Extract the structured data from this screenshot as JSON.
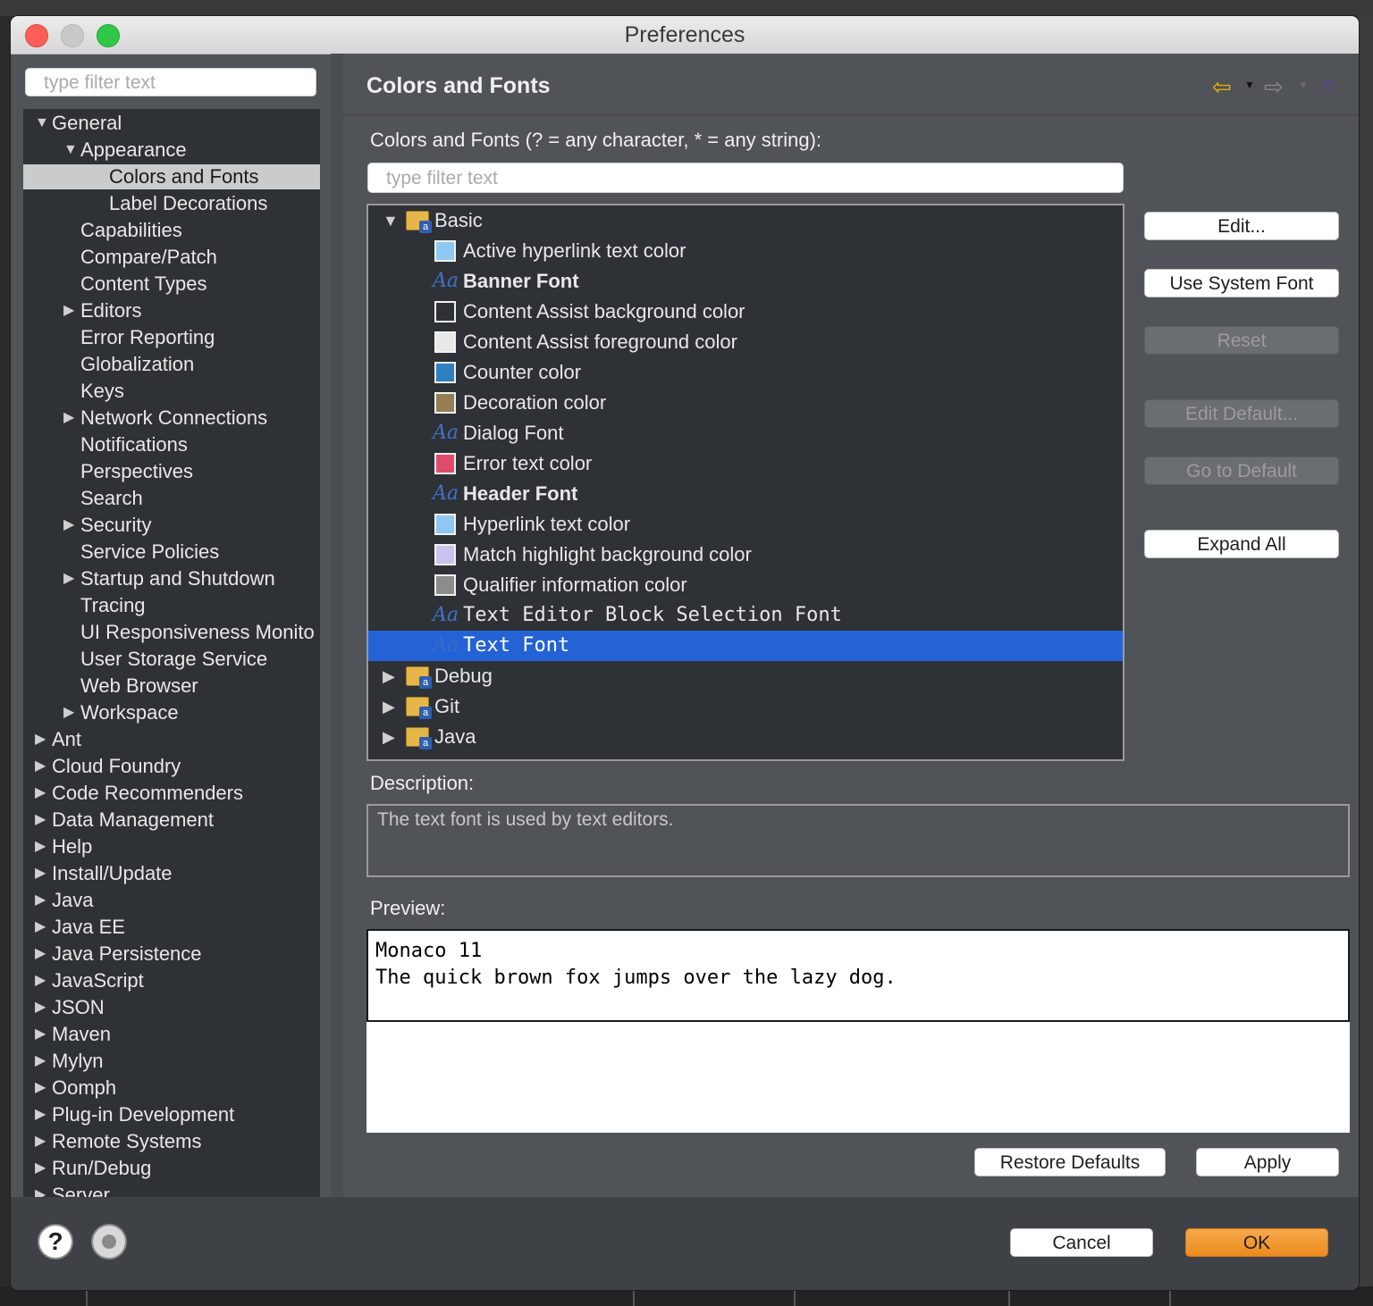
{
  "window": {
    "title": "Preferences"
  },
  "left": {
    "filter_placeholder": "type filter text",
    "tree": [
      {
        "label": "General",
        "expanded": true
      },
      {
        "label": "Appearance",
        "expanded": true
      },
      {
        "label": "Colors and Fonts",
        "selected": true
      },
      {
        "label": "Label Decorations"
      },
      {
        "label": "Capabilities"
      },
      {
        "label": "Compare/Patch"
      },
      {
        "label": "Content Types"
      },
      {
        "label": "Editors"
      },
      {
        "label": "Error Reporting"
      },
      {
        "label": "Globalization"
      },
      {
        "label": "Keys"
      },
      {
        "label": "Network Connections"
      },
      {
        "label": "Notifications"
      },
      {
        "label": "Perspectives"
      },
      {
        "label": "Search"
      },
      {
        "label": "Security"
      },
      {
        "label": "Service Policies"
      },
      {
        "label": "Startup and Shutdown"
      },
      {
        "label": "Tracing"
      },
      {
        "label": "UI Responsiveness Monito"
      },
      {
        "label": "User Storage Service"
      },
      {
        "label": "Web Browser"
      },
      {
        "label": "Workspace"
      },
      {
        "label": "Ant"
      },
      {
        "label": "Cloud Foundry"
      },
      {
        "label": "Code Recommenders"
      },
      {
        "label": "Data Management"
      },
      {
        "label": "Help"
      },
      {
        "label": "Install/Update"
      },
      {
        "label": "Java"
      },
      {
        "label": "Java EE"
      },
      {
        "label": "Java Persistence"
      },
      {
        "label": "JavaScript"
      },
      {
        "label": "JSON"
      },
      {
        "label": "Maven"
      },
      {
        "label": "Mylyn"
      },
      {
        "label": "Oomph"
      },
      {
        "label": "Plug-in Development"
      },
      {
        "label": "Remote Systems"
      },
      {
        "label": "Run/Debug"
      },
      {
        "label": "Server"
      }
    ]
  },
  "page": {
    "title": "Colors and Fonts",
    "filter_label": "Colors and Fonts (? = any character, * = any string):",
    "filter_placeholder": "type filter text",
    "tree": [
      {
        "label": "Basic",
        "kind": "category"
      },
      {
        "label": "Active hyperlink text color",
        "kind": "color",
        "color": "#8ec8f2"
      },
      {
        "label": "Banner Font",
        "kind": "font"
      },
      {
        "label": "Content Assist background color",
        "kind": "color",
        "color": "#2f3136"
      },
      {
        "label": "Content Assist foreground color",
        "kind": "color",
        "color": "#e8e8e8"
      },
      {
        "label": "Counter color",
        "kind": "color",
        "color": "#2e80c0"
      },
      {
        "label": "Decoration color",
        "kind": "color",
        "color": "#957e52"
      },
      {
        "label": "Dialog Font",
        "kind": "font"
      },
      {
        "label": "Error text color",
        "kind": "color",
        "color": "#e04b6c"
      },
      {
        "label": "Header Font",
        "kind": "font"
      },
      {
        "label": "Hyperlink text color",
        "kind": "color",
        "color": "#8ec8f2"
      },
      {
        "label": "Match highlight background color",
        "kind": "color",
        "color": "#c8c4f0"
      },
      {
        "label": "Qualifier information color",
        "kind": "color",
        "color": "#8c8c8c"
      },
      {
        "label": "Text Editor Block Selection Font",
        "kind": "font"
      },
      {
        "label": "Text Font",
        "kind": "font",
        "selected": true
      },
      {
        "label": "Debug",
        "kind": "category"
      },
      {
        "label": "Git",
        "kind": "category"
      },
      {
        "label": "Java",
        "kind": "category"
      }
    ],
    "buttons": {
      "edit": "Edit...",
      "use_system_font": "Use System Font",
      "reset": "Reset",
      "edit_default": "Edit Default...",
      "go_to_default": "Go to Default",
      "expand_all": "Expand All"
    },
    "description_label": "Description:",
    "description": "The text font is used by text editors.",
    "preview_label": "Preview:",
    "preview_line1": "Monaco 11",
    "preview_line2": "The quick brown fox jumps over the lazy dog.",
    "restore_defaults": "Restore Defaults",
    "apply": "Apply"
  },
  "footer": {
    "cancel": "Cancel",
    "ok": "OK"
  },
  "icons": {
    "font_glyph": "Aa",
    "help": "?",
    "folder_badge": "a"
  },
  "colors": {
    "selection": "#2463d6",
    "ok_button": "#ec8a1e"
  }
}
